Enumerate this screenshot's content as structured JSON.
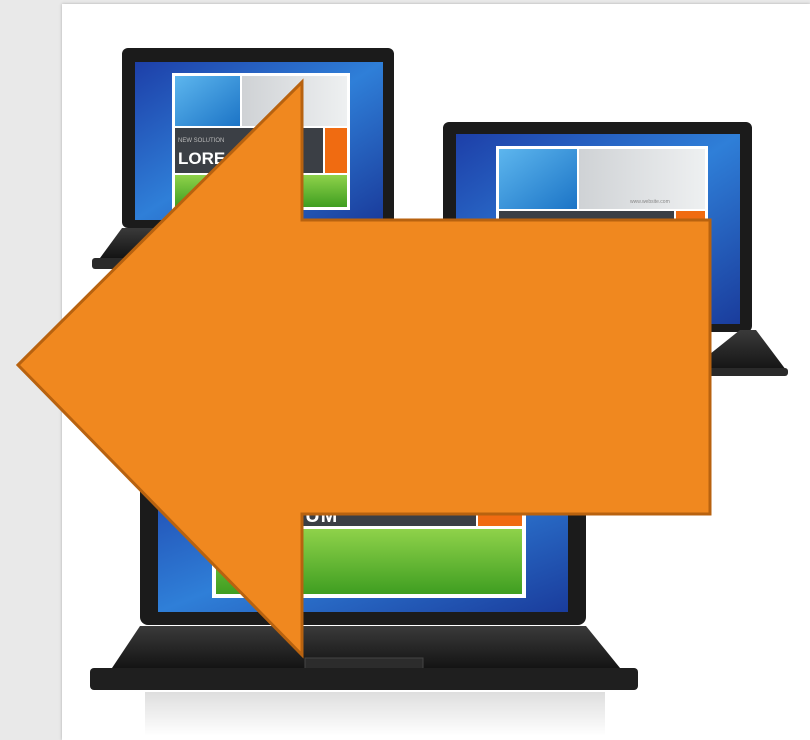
{
  "scene": {
    "background_color": "#e9e9e9",
    "card_color": "#ffffff",
    "arrow_color": "#f0881f",
    "arrow_outline_color": "#b8620f",
    "arrow_direction": "left",
    "screen_color": "#2a6fc6"
  },
  "laptops": {
    "back_left": {
      "heading": "LORE",
      "small_text": "NEW SOLUTION"
    },
    "back_right": {
      "small_text": "www.website.com"
    },
    "front": {
      "heading": "IPSUM"
    }
  }
}
